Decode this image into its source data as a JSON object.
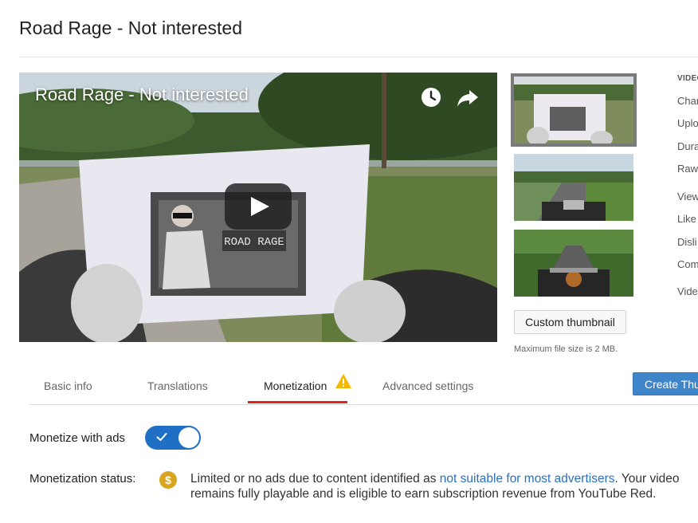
{
  "page": {
    "title": "Road Rage - Not interested"
  },
  "player": {
    "overlay_title": "Road Rage - Not interested",
    "sign_text": "ROAD RAGE",
    "icons": [
      "clock-icon",
      "share-arrow-icon",
      "play-icon"
    ]
  },
  "thumbnails": {
    "custom_button": "Custom thumbnail",
    "note": "Maximum file size is 2 MB."
  },
  "info": {
    "heading": "VIDEO",
    "rows": [
      "Char",
      "Uplo",
      "Dura",
      "Raw",
      "View",
      "Like",
      "Disli",
      "Com",
      "Vide"
    ]
  },
  "tabs": [
    {
      "label": "Basic info"
    },
    {
      "label": "Translations"
    },
    {
      "label": "Monetization",
      "active": true,
      "warning": true
    },
    {
      "label": "Advanced settings"
    }
  ],
  "create_button": "Create Thu",
  "monetize": {
    "label": "Monetize with ads",
    "enabled": true
  },
  "status": {
    "label": "Monetization status:",
    "text_before": "Limited or no ads due to content identified as ",
    "link": "not suitable for most advertisers",
    "text_after": ". Your video remains fully playable and is eligible to earn subscription revenue from YouTube Red."
  },
  "colors": {
    "accent_blue": "#1f6fc5",
    "tab_underline": "#e62117",
    "warning": "#f6b800",
    "coin": "#d9a521",
    "link": "#2a6fc0"
  }
}
